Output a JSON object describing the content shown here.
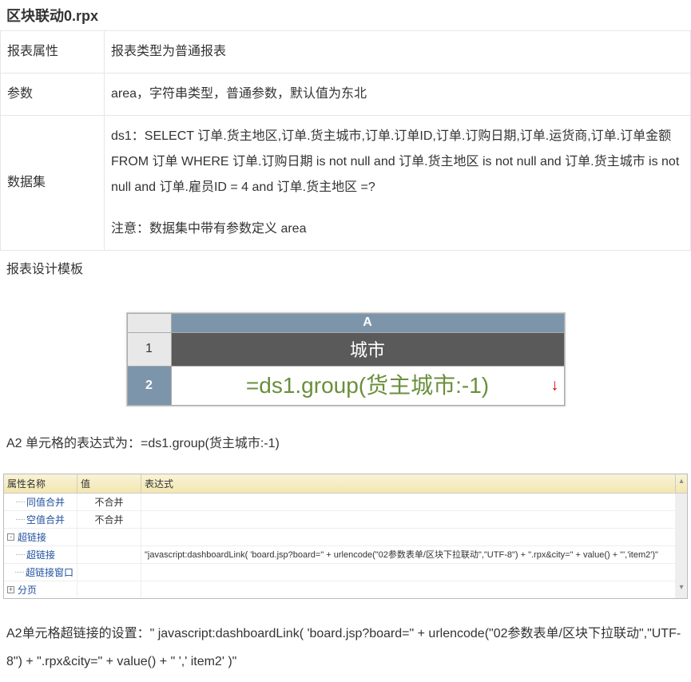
{
  "title": "区块联动0.rpx",
  "rows": {
    "report_prop": {
      "label": "报表属性",
      "value": "报表类型为普通报表"
    },
    "params": {
      "label": "参数",
      "value": "area，字符串类型，普通参数，默认值为东北"
    },
    "dataset": {
      "label": "数据集",
      "sql": "ds1：SELECT 订单.货主地区,订单.货主城市,订单.订单ID,订单.订购日期,订单.运货商,订单.订单金额 FROM 订单 WHERE 订单.订购日期 is not null and 订单.货主地区 is not null and 订单.货主城市 is not null and 订单.雇员ID = 4 and 订单.货主地区  =?",
      "note": "注意：数据集中带有参数定义 area"
    }
  },
  "design_template_label": "报表设计模板",
  "grid": {
    "col_a": "A",
    "row1": "1",
    "row2": "2",
    "a1": "城市",
    "a2": "=ds1.group(货主城市:-1)"
  },
  "a2_expr_line": "A2 单元格的表达式为：=ds1.group(货主城市:-1)",
  "prop": {
    "headers": {
      "name": "属性名称",
      "value": "值",
      "expr": "表达式"
    },
    "items": [
      {
        "toggle": "",
        "indent": 1,
        "name": "同值合并",
        "value": "不合并",
        "expr": ""
      },
      {
        "toggle": "",
        "indent": 1,
        "name": "空值合并",
        "value": "不合并",
        "expr": ""
      },
      {
        "toggle": "-",
        "indent": 0,
        "name": "超链接",
        "value": "",
        "expr": ""
      },
      {
        "toggle": "",
        "indent": 1,
        "name": "超链接",
        "value": "",
        "expr": "\"javascript:dashboardLink( 'board.jsp?board=\" + urlencode(\"02参数表单/区块下拉联动\",\"UTF-8\") + \".rpx&city=\" + value() + \"','item2')\""
      },
      {
        "toggle": "",
        "indent": 1,
        "name": "超链接窗口",
        "value": "",
        "expr": ""
      },
      {
        "toggle": "+",
        "indent": 0,
        "name": "分页",
        "value": "",
        "expr": ""
      }
    ]
  },
  "explain": "A2单元格超链接的设置：\" javascript:dashboardLink(  'board.jsp?board=\"  + urlencode(\"02参数表单/区块下拉联动\",\"UTF-8\") +  \".rpx&city=\"  + value() +  \" ',' item2' )\""
}
